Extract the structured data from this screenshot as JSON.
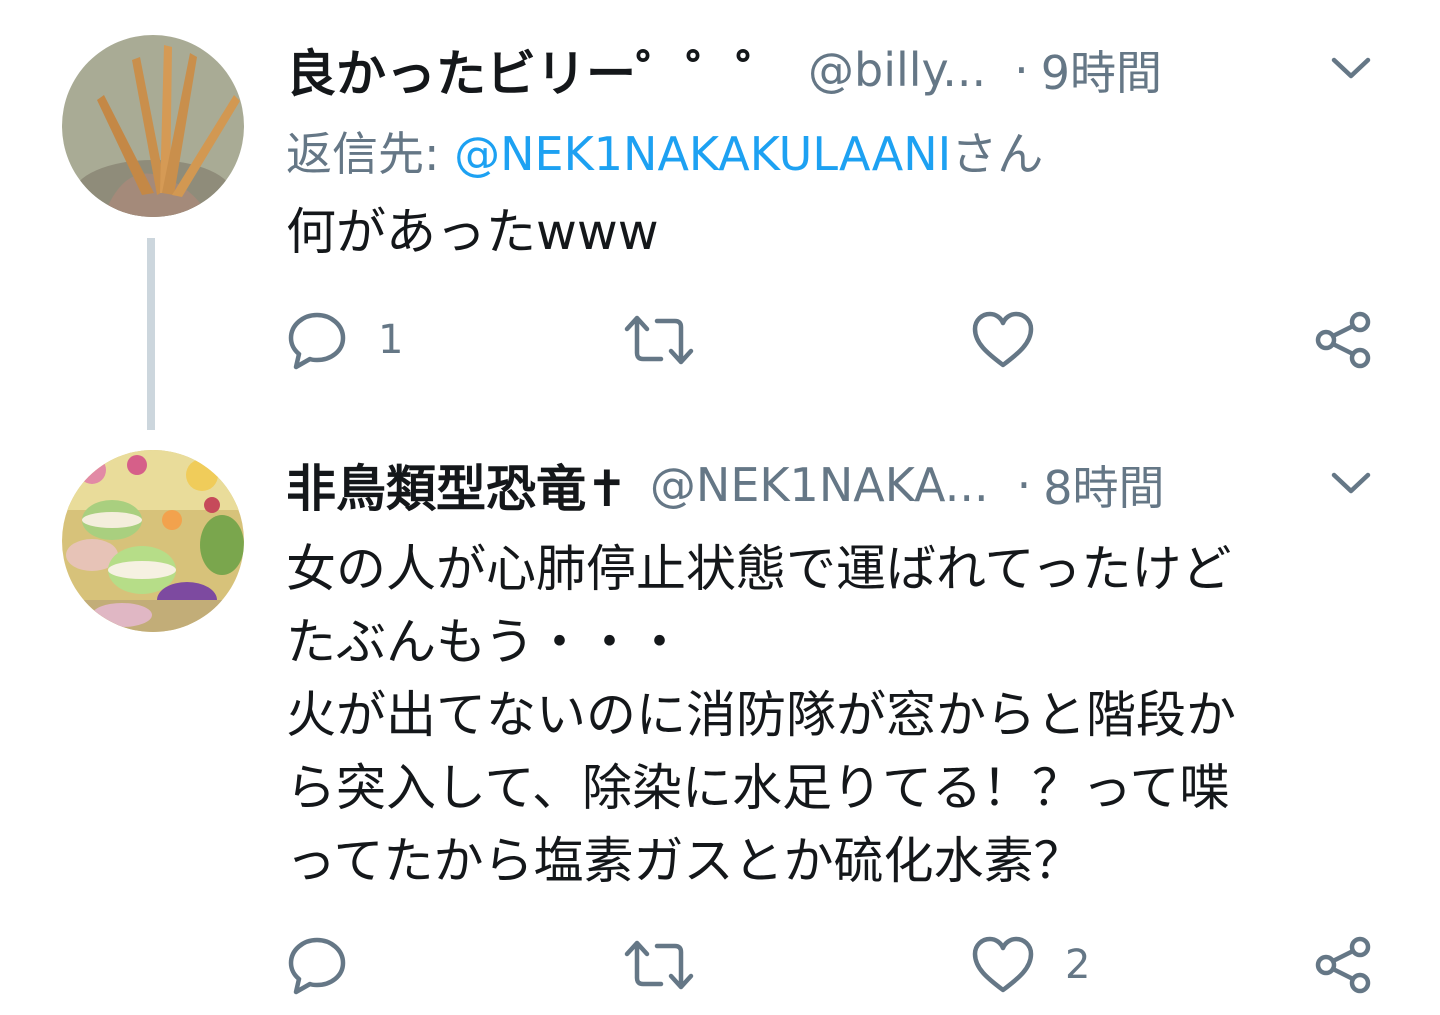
{
  "tweets": [
    {
      "display_name": "良かったビリー゜゜゜",
      "handle": "@billy...",
      "separator": "·",
      "time": "9時間",
      "reply_label": "返信先: ",
      "reply_mention": "@NEK1NAKAKULAANI",
      "reply_suffix": "さん",
      "body_lines": [
        "何があったwww"
      ],
      "reply_count": "1",
      "retweet_count": "",
      "like_count": ""
    },
    {
      "display_name": "非鳥類型恐竜✝",
      "handle": "@NEK1NAKA...",
      "separator": "·",
      "time": "8時間",
      "body_lines": [
        "女の人が心肺停止状態で運ばれてったけど",
        "たぶんもう・・・",
        "火が出てないのに消防隊が窓からと階段か",
        "ら突入して、除染に水足りてる！？って喋",
        "ってたから塩素ガスとか硫化水素？"
      ],
      "reply_count": "",
      "retweet_count": "",
      "like_count": "2"
    }
  ],
  "icons": {
    "reply": "reply-icon",
    "retweet": "retweet-icon",
    "like": "heart-icon",
    "share": "share-icon",
    "caret": "chevron-down-icon"
  },
  "colors": {
    "text": "#14171a",
    "secondary": "#657786",
    "link": "#1da1f2",
    "thread_line": "#ccd6dd",
    "icon": "#657786"
  }
}
